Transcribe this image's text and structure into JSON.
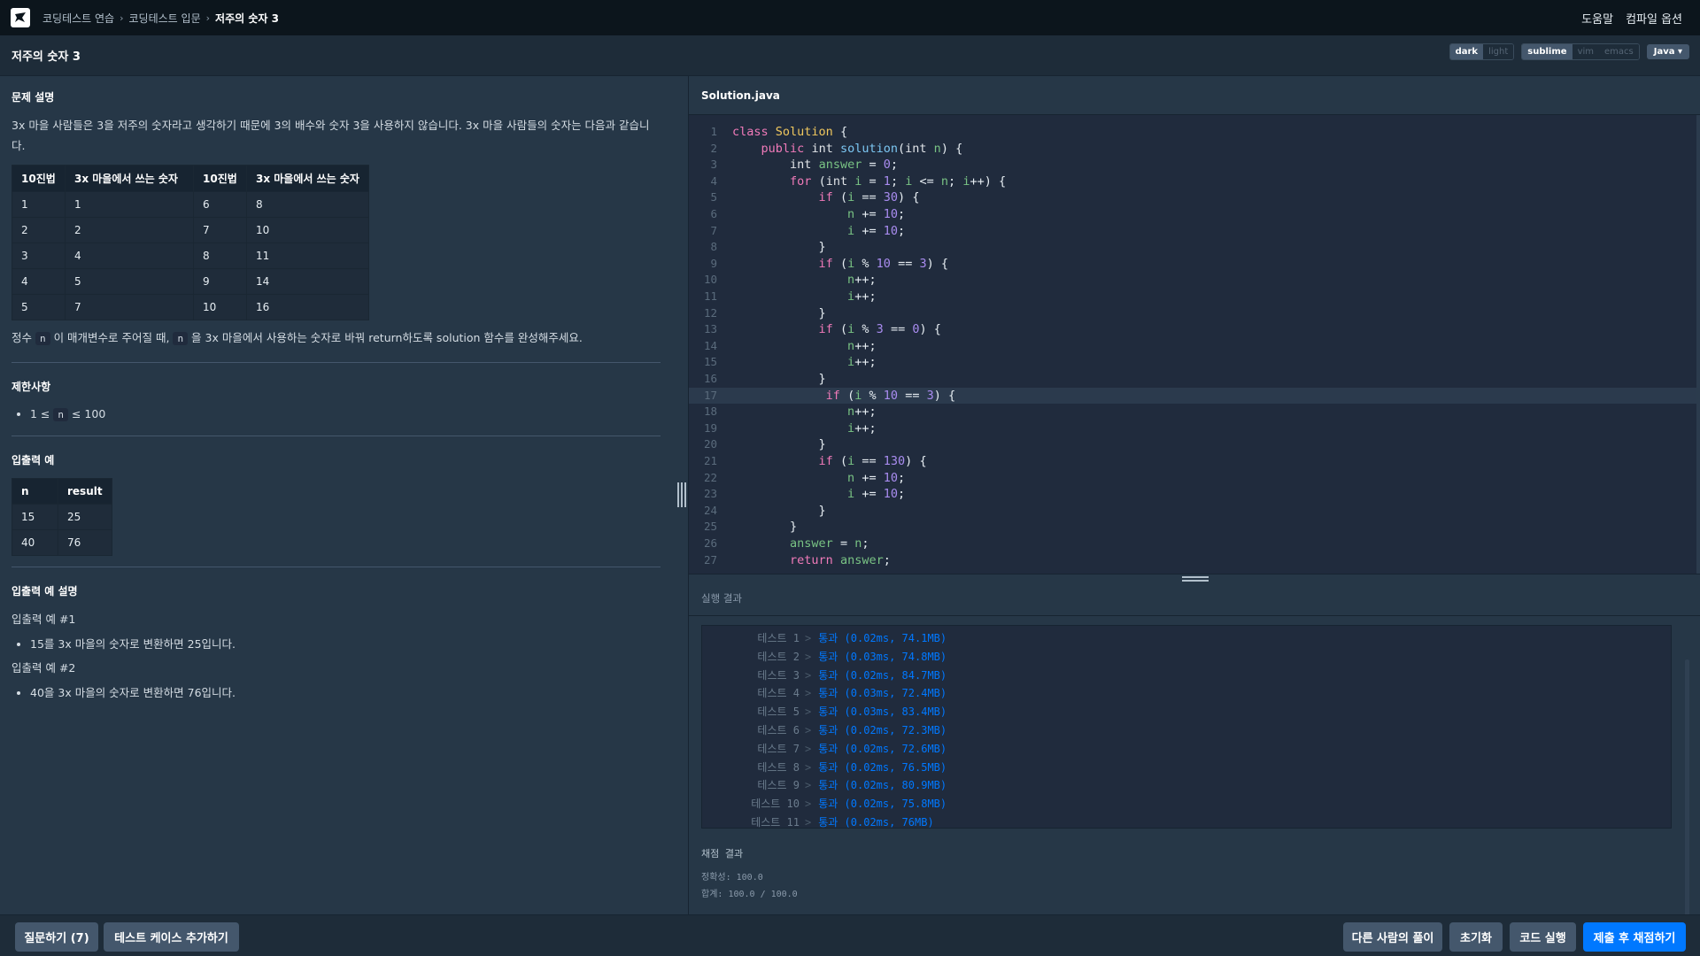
{
  "nav": {
    "breadcrumbs": [
      "코딩테스트 연습",
      "코딩테스트 입문",
      "저주의 숫자 3"
    ],
    "help": "도움말",
    "compile_options": "컴파일 옵션"
  },
  "titlebar": {
    "title": "저주의 숫자 3",
    "themes": [
      "dark",
      "light"
    ],
    "active_theme": "dark",
    "keymaps": [
      "sublime",
      "vim",
      "emacs"
    ],
    "active_keymap": "sublime",
    "language": "Java"
  },
  "problem": {
    "desc_title": "문제 설명",
    "desc_text": "3x 마을 사람들은 3을 저주의 숫자라고 생각하기 때문에 3의 배수와 숫자 3을 사용하지 않습니다. 3x 마을 사람들의 숫자는 다음과 같습니다.",
    "table_headers": [
      "10진법",
      "3x 마을에서 쓰는 숫자",
      "10진법",
      "3x 마을에서 쓰는 숫자"
    ],
    "table_rows": [
      [
        "1",
        "1",
        "6",
        "8"
      ],
      [
        "2",
        "2",
        "7",
        "10"
      ],
      [
        "3",
        "4",
        "8",
        "11"
      ],
      [
        "4",
        "5",
        "9",
        "14"
      ],
      [
        "5",
        "7",
        "10",
        "16"
      ]
    ],
    "task_parts": [
      "정수 ",
      "n",
      " 이 매개변수로 주어질 때, ",
      "n",
      " 을 3x 마을에서 사용하는 숫자로 바꿔 return하도록 solution 함수를 완성해주세요."
    ],
    "constraints_title": "제한사항",
    "constraint_parts": [
      "1 ≤ ",
      "n",
      " ≤ 100"
    ],
    "io_title": "입출력 예",
    "io_headers": [
      "n",
      "result"
    ],
    "io_rows": [
      [
        "15",
        "25"
      ],
      [
        "40",
        "76"
      ]
    ],
    "io_desc_title": "입출력 예 설명",
    "io_desc": [
      {
        "title": "입출력 예 #1",
        "text": "15를 3x 마을의 숫자로 변환하면 25입니다."
      },
      {
        "title": "입출력 예 #2",
        "text": "40을 3x 마을의 숫자로 변환하면 76입니다."
      }
    ]
  },
  "editor": {
    "filename": "Solution.java",
    "lines": [
      "class Solution {",
      "    public int solution(int n) {",
      "        int answer = 0;",
      "        for (int i = 1; i <= n; i++) {",
      "            if (i == 30) {",
      "                n += 10;",
      "                i += 10;",
      "            }",
      "            if (i % 10 == 3) {",
      "                n++;",
      "                i++;",
      "            }",
      "            if (i % 3 == 0) {",
      "                n++;",
      "                i++;",
      "            }",
      "             if (i % 10 == 3) {",
      "                n++;",
      "                i++;",
      "            }",
      "            if (i == 130) {",
      "                n += 10;",
      "                i += 10;",
      "            }",
      "        }",
      "        answer = n;",
      "        return answer;"
    ],
    "highlighted_line": 17
  },
  "results": {
    "header": "실행 결과",
    "tests": [
      {
        "label": "테스트 1",
        "result": "통과 (0.02ms, 74.1MB)"
      },
      {
        "label": "테스트 2",
        "result": "통과 (0.03ms, 74.8MB)"
      },
      {
        "label": "테스트 3",
        "result": "통과 (0.02ms, 84.7MB)"
      },
      {
        "label": "테스트 4",
        "result": "통과 (0.03ms, 72.4MB)"
      },
      {
        "label": "테스트 5",
        "result": "통과 (0.03ms, 83.4MB)"
      },
      {
        "label": "테스트 6",
        "result": "통과 (0.02ms, 72.3MB)"
      },
      {
        "label": "테스트 7",
        "result": "통과 (0.02ms, 72.6MB)"
      },
      {
        "label": "테스트 8",
        "result": "통과 (0.02ms, 76.5MB)"
      },
      {
        "label": "테스트 9",
        "result": "통과 (0.02ms, 80.9MB)"
      },
      {
        "label": "테스트 10",
        "result": "통과 (0.02ms, 75.8MB)"
      },
      {
        "label": "테스트 11",
        "result": "통과 (0.02ms, 76MB)"
      }
    ],
    "score_title": "채점 결과",
    "accuracy": "정확성: 100.0",
    "total": "합계: 100.0 / 100.0"
  },
  "bottom": {
    "question": "질문하기 (7)",
    "add_testcase": "테스트 케이스 추가하기",
    "others": "다른 사람의 풀이",
    "reset": "초기화",
    "run": "코드 실행",
    "submit": "제출 후 채점하기"
  },
  "colors": {
    "background": "#263747",
    "topnav": "#0c151c",
    "editor": "#202b3d",
    "primary": "#0078ff",
    "pass": "#0078ff"
  }
}
